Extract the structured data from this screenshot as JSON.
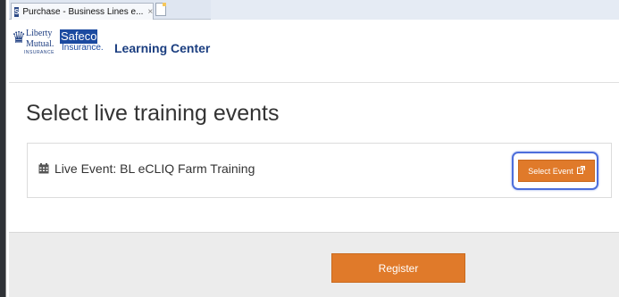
{
  "browser": {
    "tab_title": "Purchase - Business Lines e...",
    "tab_close": "×",
    "favicon": "S"
  },
  "header": {
    "logo_liberty_line1": "Liberty",
    "logo_liberty_line2": "Mutual.",
    "logo_liberty_line3": "INSURANCE",
    "logo_safeco_word": "Safeco",
    "logo_safeco_line2": "Insurance.",
    "title": "Learning Center"
  },
  "main": {
    "page_title": "Select live training events",
    "event": {
      "icon": "calendar-icon",
      "label": "Live Event: BL eCLIQ Farm Training",
      "select_button_label": "Select Event",
      "select_button_icon": "external-link-icon"
    },
    "register_button_label": "Register"
  },
  "colors": {
    "accent_orange": "#e07a2a",
    "highlight_blue": "#4d6edb",
    "brand_blue": "#1b3e80"
  }
}
